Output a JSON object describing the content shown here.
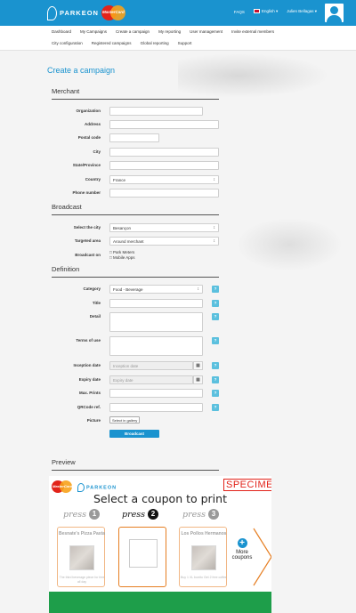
{
  "brand": {
    "name": "PARKEON",
    "mastercard": "MasterCard"
  },
  "topbar": {
    "faqs": "FAQS",
    "language": "English ▾",
    "user": "Julien Bellagas ▾"
  },
  "nav": {
    "row1": [
      "Dashboard",
      "My Campaigns",
      "Create a campaign",
      "My reporting",
      "User management",
      "Invite external members"
    ],
    "row2": [
      "City configuration",
      "Registered campaigns",
      "Global reporting",
      "Support"
    ]
  },
  "page": {
    "title": "Create a campaign"
  },
  "merchant": {
    "title": "Merchant",
    "organization": {
      "label": "Organization",
      "value": ""
    },
    "address": {
      "label": "Address",
      "value": ""
    },
    "postal_code": {
      "label": "Postal code",
      "value": ""
    },
    "city": {
      "label": "City",
      "value": ""
    },
    "state": {
      "label": "State/Province",
      "value": ""
    },
    "country": {
      "label": "Country",
      "value": "France"
    },
    "phone": {
      "label": "Phone number",
      "value": ""
    }
  },
  "broadcast": {
    "title": "Broadcast",
    "city": {
      "label": "Select the city",
      "value": "Besançon"
    },
    "area": {
      "label": "Targeted area",
      "value": "Around merchant"
    },
    "on": {
      "label": "Broadcast on",
      "options": [
        "Park Meters",
        "Mobile Apps"
      ]
    }
  },
  "definition": {
    "title": "Definition",
    "category": {
      "label": "Category",
      "value": "Food - Beverage"
    },
    "title_field": {
      "label": "Title",
      "value": ""
    },
    "detail": {
      "label": "Detail",
      "value": ""
    },
    "terms": {
      "label": "Terms of use",
      "value": ""
    },
    "inception": {
      "label": "Inception date",
      "placeholder": "Inception date"
    },
    "expiry": {
      "label": "Expiry date",
      "placeholder": "Expiry date"
    },
    "max_prints": {
      "label": "Max. Prints",
      "value": ""
    },
    "qrcode": {
      "label": "QRCode ref.",
      "value": ""
    },
    "picture": {
      "label": "Picture",
      "button": "Select in gallery"
    },
    "help": "?",
    "calendar": "▦",
    "submit": "Broadcast"
  },
  "preview": {
    "title": "Preview",
    "specimen": "SPECIMEN",
    "heading": "Select a coupon to print",
    "press": [
      {
        "word": "press",
        "num": "1"
      },
      {
        "word": "press",
        "num": "2"
      },
      {
        "word": "press",
        "num": "3"
      }
    ],
    "coupons": [
      {
        "title": "Besnate's Pizza Pasta",
        "desc": "The third beverage piece for free all day"
      },
      {
        "title": "",
        "desc": ""
      },
      {
        "title": "Los Pollos Hermanos",
        "desc": "Buy 1 XL burrito Get 2 free coffee"
      }
    ],
    "more": {
      "plus": "+",
      "label": "More coupons"
    }
  },
  "colors": {
    "brand_blue": "#1a93cf",
    "help_blue": "#5bc0de",
    "accent_orange": "#e67e22",
    "footer_green": "#1e9e4a",
    "specimen_red": "#e2231a"
  }
}
